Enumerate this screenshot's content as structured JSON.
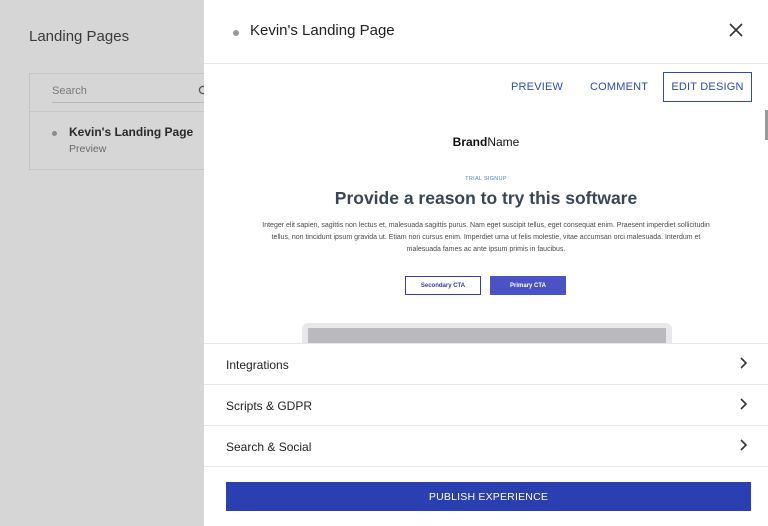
{
  "background": {
    "title": "Landing Pages",
    "search": {
      "placeholder": "Search"
    },
    "items": [
      {
        "title": "Kevin's Landing Page",
        "subtitle": "Preview"
      }
    ]
  },
  "drawer": {
    "title": "Kevin's Landing Page",
    "actions": {
      "preview": "PREVIEW",
      "comment": "COMMENT",
      "edit_design": "EDIT DESIGN"
    },
    "preview": {
      "brand_bold": "Brand",
      "brand_regular": "Name",
      "eyebrow": "TRIAL SIGNUP",
      "headline": "Provide a reason to try this software",
      "body": "Integer elit sapien, sagittis non lectus et, malesuada sagittis purus. Nam eget suscipit tellus, eget consequat enim. Praesent imperdiet sollicitudin tellus, non tincidunt ipsum gravida ut. Etiam non cursus enim. Imperdiet urna ut felis molestie, vitae accumsan orci malesuada. Interdum et malesuada fames ac ante ipsum primis in faucibus.",
      "secondary_cta": "Secondary CTA",
      "primary_cta": "Primary CTA"
    },
    "sections": [
      {
        "label": "Integrations"
      },
      {
        "label": "Scripts & GDPR"
      },
      {
        "label": "Search & Social"
      }
    ],
    "publish_label": "PUBLISH EXPERIENCE"
  },
  "colors": {
    "accent": "#2b4bb7",
    "publish": "#2a3fb0",
    "primary_cta": "#4a52c4",
    "overlay": "#d6d6d6"
  },
  "icons": {
    "search": "search-icon",
    "close": "close-icon",
    "chevron": "chevron-right-icon"
  }
}
